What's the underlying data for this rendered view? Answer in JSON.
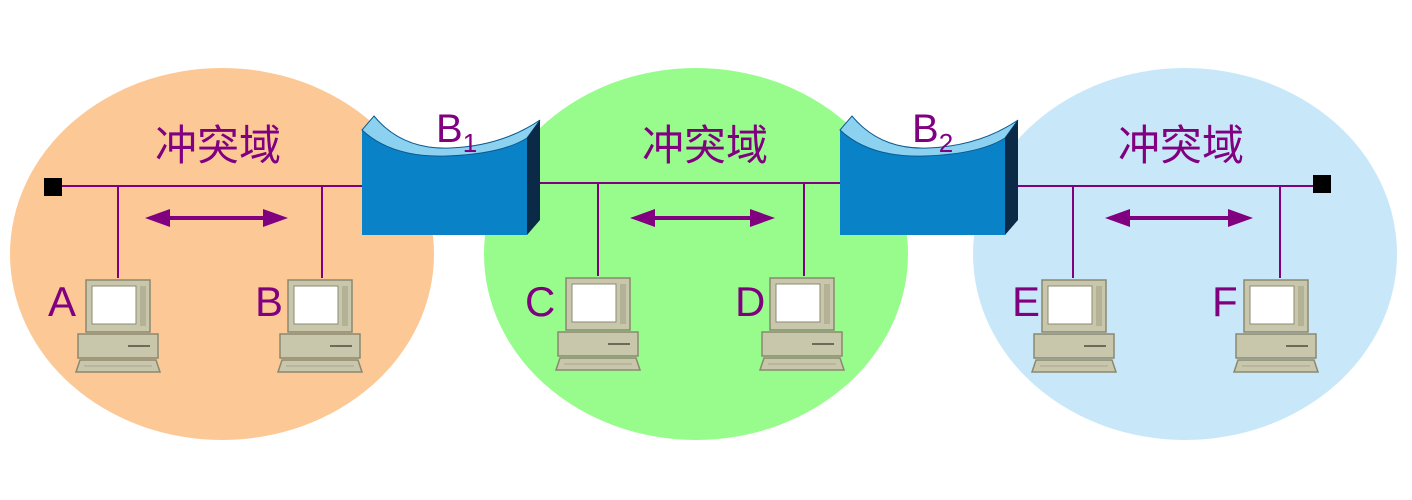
{
  "colors": {
    "domain_left": "#fcc896",
    "domain_middle": "#98fc8c",
    "domain_right": "#c8e8fa",
    "wire": "#800080",
    "label": "#800080",
    "bridge_front": "#0a82c8",
    "bridge_top": "#8cd2f0",
    "bridge_side": "#0a2a48"
  },
  "domains": [
    {
      "label": "冲突域"
    },
    {
      "label": "冲突域"
    },
    {
      "label": "冲突域"
    }
  ],
  "bridges": [
    {
      "letter": "B",
      "subscript": "1",
      "icon": "bridge-icon"
    },
    {
      "letter": "B",
      "subscript": "2",
      "icon": "bridge-icon"
    }
  ],
  "hosts": [
    {
      "label": "A",
      "icon": "computer-icon"
    },
    {
      "label": "B",
      "icon": "computer-icon"
    },
    {
      "label": "C",
      "icon": "computer-icon"
    },
    {
      "label": "D",
      "icon": "computer-icon"
    },
    {
      "label": "E",
      "icon": "computer-icon"
    },
    {
      "label": "F",
      "icon": "computer-icon"
    }
  ]
}
